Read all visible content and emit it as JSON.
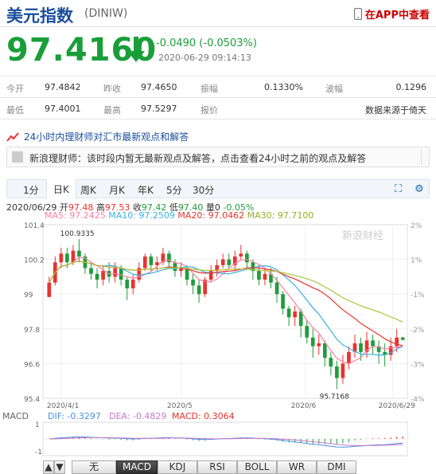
{
  "header": {
    "title": "美元指数",
    "code": "(DINIW)",
    "app_link": "在APP中查看"
  },
  "quote": {
    "price": "97.4160",
    "change": "-0.0490 (-0.0503%)",
    "time": "2020-06-29 09:14:13"
  },
  "stats": {
    "open_label": "今开",
    "open": "97.4842",
    "prev_label": "昨收",
    "prev": "97.4650",
    "amp_label": "振幅",
    "amp": "0.1330%",
    "wave_label": "波幅",
    "wave": "0.1296",
    "low_label": "最低",
    "low": "97.4001",
    "high_label": "最高",
    "high": "97.5297",
    "quote_label": "报价",
    "source": "数据来源于倚天"
  },
  "news": {
    "head": "24小时内理财师对汇市最新观点和解答",
    "text": "新浪理财师：该时段内暂无最新观点及解答，点击查看24小时之前的观点及解答"
  },
  "tabs": [
    "1分",
    "日K",
    "周K",
    "月K",
    "年K",
    "5分",
    "30分"
  ],
  "active_tab": "日K",
  "chart_info": {
    "date": "2020/06/29",
    "open_label": "开",
    "open": "97.48",
    "high_label": "高",
    "high": "97.53",
    "close_label": "收",
    "close": "97.42",
    "low_label": "低",
    "low": "97.40",
    "vol_label": "量",
    "vol": "0",
    "pct": "-0.05%"
  },
  "ma": {
    "ma5": "MA5: 97.2425",
    "ma10": "MA10: 97.2509",
    "ma20": "MA20: 97.0462",
    "ma30": "MA30: 97.7100"
  },
  "macd": {
    "label": "MACD",
    "dif": "DIF: -0.3297",
    "dea": "DEA: -0.4829",
    "macd": "MACD: 0.3064"
  },
  "watermark": "新浪财经",
  "colors": {
    "up": "#e8332f",
    "down": "#1f9c3b",
    "ma5": "#ff7fa3",
    "ma10": "#3ab0e6",
    "ma20": "#e8332f",
    "ma30": "#b0c43a",
    "dif": "#4a90e2",
    "dea": "#c879c8"
  },
  "buttons": [
    "无",
    "MACD",
    "KDJ",
    "RSI",
    "BOLL",
    "WR",
    "DMI"
  ],
  "active_button": "MACD",
  "chart_data": {
    "type": "candlestick",
    "y_ticks": [
      "101.4",
      "100.2",
      "99",
      "97.8",
      "96.6",
      "95.4"
    ],
    "y_ticks_right": [
      "2%",
      "1%",
      "-1%",
      "-2%",
      "-3%",
      "-4%"
    ],
    "x_ticks": [
      "2020/4/1",
      "2020/5",
      "2020/6",
      "2020/6/29"
    ],
    "ylim": [
      95.4,
      101.4
    ],
    "annotations": {
      "max": "100.9335",
      "min": "95.7168"
    },
    "macd_ticks": [
      "1",
      "-1"
    ],
    "candles": [
      [
        98.9,
        99.4,
        99.6,
        98.9
      ],
      [
        99.4,
        100.1,
        100.3,
        99.3
      ],
      [
        100.1,
        100.4,
        100.6,
        99.9
      ],
      [
        100.4,
        100.1,
        100.6,
        99.9
      ],
      [
        100.1,
        100.5,
        100.7,
        100.0
      ],
      [
        100.5,
        100.3,
        100.9,
        100.1
      ],
      [
        100.3,
        99.9,
        100.4,
        99.7
      ],
      [
        99.9,
        99.7,
        100.1,
        99.5
      ],
      [
        99.7,
        99.5,
        99.9,
        99.2
      ],
      [
        99.5,
        99.8,
        100.0,
        99.3
      ],
      [
        99.8,
        99.6,
        100.1,
        99.4
      ],
      [
        99.6,
        99.9,
        100.1,
        99.4
      ],
      [
        99.9,
        99.5,
        100.0,
        99.3
      ],
      [
        99.5,
        99.2,
        99.6,
        98.8
      ],
      [
        99.2,
        99.5,
        99.7,
        99.0
      ],
      [
        99.5,
        99.9,
        100.1,
        99.4
      ],
      [
        99.9,
        100.3,
        100.4,
        99.8
      ],
      [
        100.3,
        100.0,
        100.4,
        99.8
      ],
      [
        100.0,
        100.1,
        100.3,
        99.8
      ],
      [
        100.1,
        100.4,
        100.6,
        100.0
      ],
      [
        100.4,
        100.1,
        100.5,
        99.9
      ],
      [
        100.1,
        99.8,
        100.2,
        99.6
      ],
      [
        99.8,
        99.9,
        100.1,
        99.6
      ],
      [
        99.9,
        99.5,
        100.0,
        99.3
      ],
      [
        99.5,
        99.3,
        99.7,
        99.0
      ],
      [
        99.3,
        99.0,
        99.5,
        98.7
      ],
      [
        99.0,
        99.5,
        99.6,
        98.9
      ],
      [
        99.5,
        99.8,
        100.0,
        99.4
      ],
      [
        99.8,
        100.0,
        100.2,
        99.6
      ],
      [
        100.0,
        100.2,
        100.4,
        99.9
      ],
      [
        100.2,
        100.0,
        100.4,
        99.9
      ],
      [
        100.0,
        100.3,
        100.5,
        99.8
      ],
      [
        100.3,
        100.4,
        100.7,
        100.2
      ],
      [
        100.4,
        100.1,
        100.5,
        99.9
      ],
      [
        100.1,
        99.8,
        100.2,
        99.5
      ],
      [
        99.8,
        99.5,
        100.0,
        99.3
      ],
      [
        99.5,
        99.7,
        99.9,
        99.3
      ],
      [
        99.7,
        99.4,
        99.9,
        99.2
      ],
      [
        99.4,
        99.0,
        99.6,
        98.7
      ],
      [
        99.0,
        98.5,
        99.1,
        98.3
      ],
      [
        98.5,
        98.2,
        98.6,
        97.9
      ],
      [
        98.2,
        98.4,
        98.6,
        97.9
      ],
      [
        98.4,
        97.9,
        98.5,
        97.5
      ],
      [
        97.9,
        97.5,
        98.1,
        97.3
      ],
      [
        97.5,
        97.2,
        97.8,
        96.8
      ],
      [
        97.2,
        97.3,
        97.6,
        96.9
      ],
      [
        97.3,
        96.8,
        97.4,
        96.5
      ],
      [
        96.8,
        96.5,
        97.0,
        96.2
      ],
      [
        96.5,
        96.1,
        96.7,
        95.7168
      ],
      [
        96.1,
        96.6,
        96.9,
        95.9
      ],
      [
        96.6,
        97.0,
        97.2,
        96.4
      ],
      [
        97.0,
        97.3,
        97.6,
        96.8
      ],
      [
        97.3,
        97.0,
        97.5,
        96.7
      ],
      [
        97.0,
        97.4,
        97.7,
        96.8
      ],
      [
        97.4,
        97.2,
        97.6,
        96.9
      ],
      [
        97.2,
        97.0,
        97.4,
        96.6
      ],
      [
        97.0,
        96.9,
        97.3,
        96.5
      ],
      [
        96.9,
        97.2,
        97.5,
        96.7
      ],
      [
        97.2,
        97.5,
        97.8,
        97.0
      ],
      [
        97.5,
        97.42,
        97.53,
        97.4
      ]
    ]
  }
}
